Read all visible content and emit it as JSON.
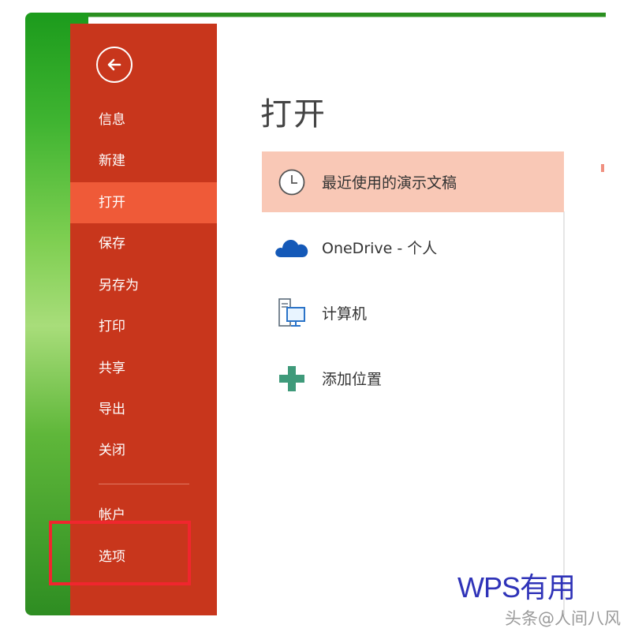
{
  "sidebar": {
    "back_icon": "arrow-left-circle-icon",
    "items": [
      {
        "label": "信息",
        "active": false
      },
      {
        "label": "新建",
        "active": false
      },
      {
        "label": "打开",
        "active": true
      },
      {
        "label": "保存",
        "active": false
      },
      {
        "label": "另存为",
        "active": false
      },
      {
        "label": "打印",
        "active": false
      },
      {
        "label": "共享",
        "active": false
      },
      {
        "label": "导出",
        "active": false
      },
      {
        "label": "关闭",
        "active": false
      }
    ],
    "bottom_items": [
      {
        "label": "帐户"
      },
      {
        "label": "选项"
      }
    ]
  },
  "main": {
    "title": "打开",
    "locations": [
      {
        "label": "最近使用的演示文稿",
        "icon": "clock-icon",
        "selected": true
      },
      {
        "label": "OneDrive - 个人",
        "icon": "cloud-icon",
        "selected": false
      },
      {
        "label": "计算机",
        "icon": "computer-icon",
        "selected": false
      },
      {
        "label": "添加位置",
        "icon": "plus-icon",
        "selected": false
      }
    ]
  },
  "watermarks": {
    "primary": "WPS有用",
    "secondary": "头条@人间八风"
  },
  "colors": {
    "sidebar_bg": "#c8361c",
    "sidebar_active": "#ef5a38",
    "selected_location": "#f9c8b6",
    "highlight_border": "#f0262e",
    "watermark_text": "#2f33b8"
  }
}
